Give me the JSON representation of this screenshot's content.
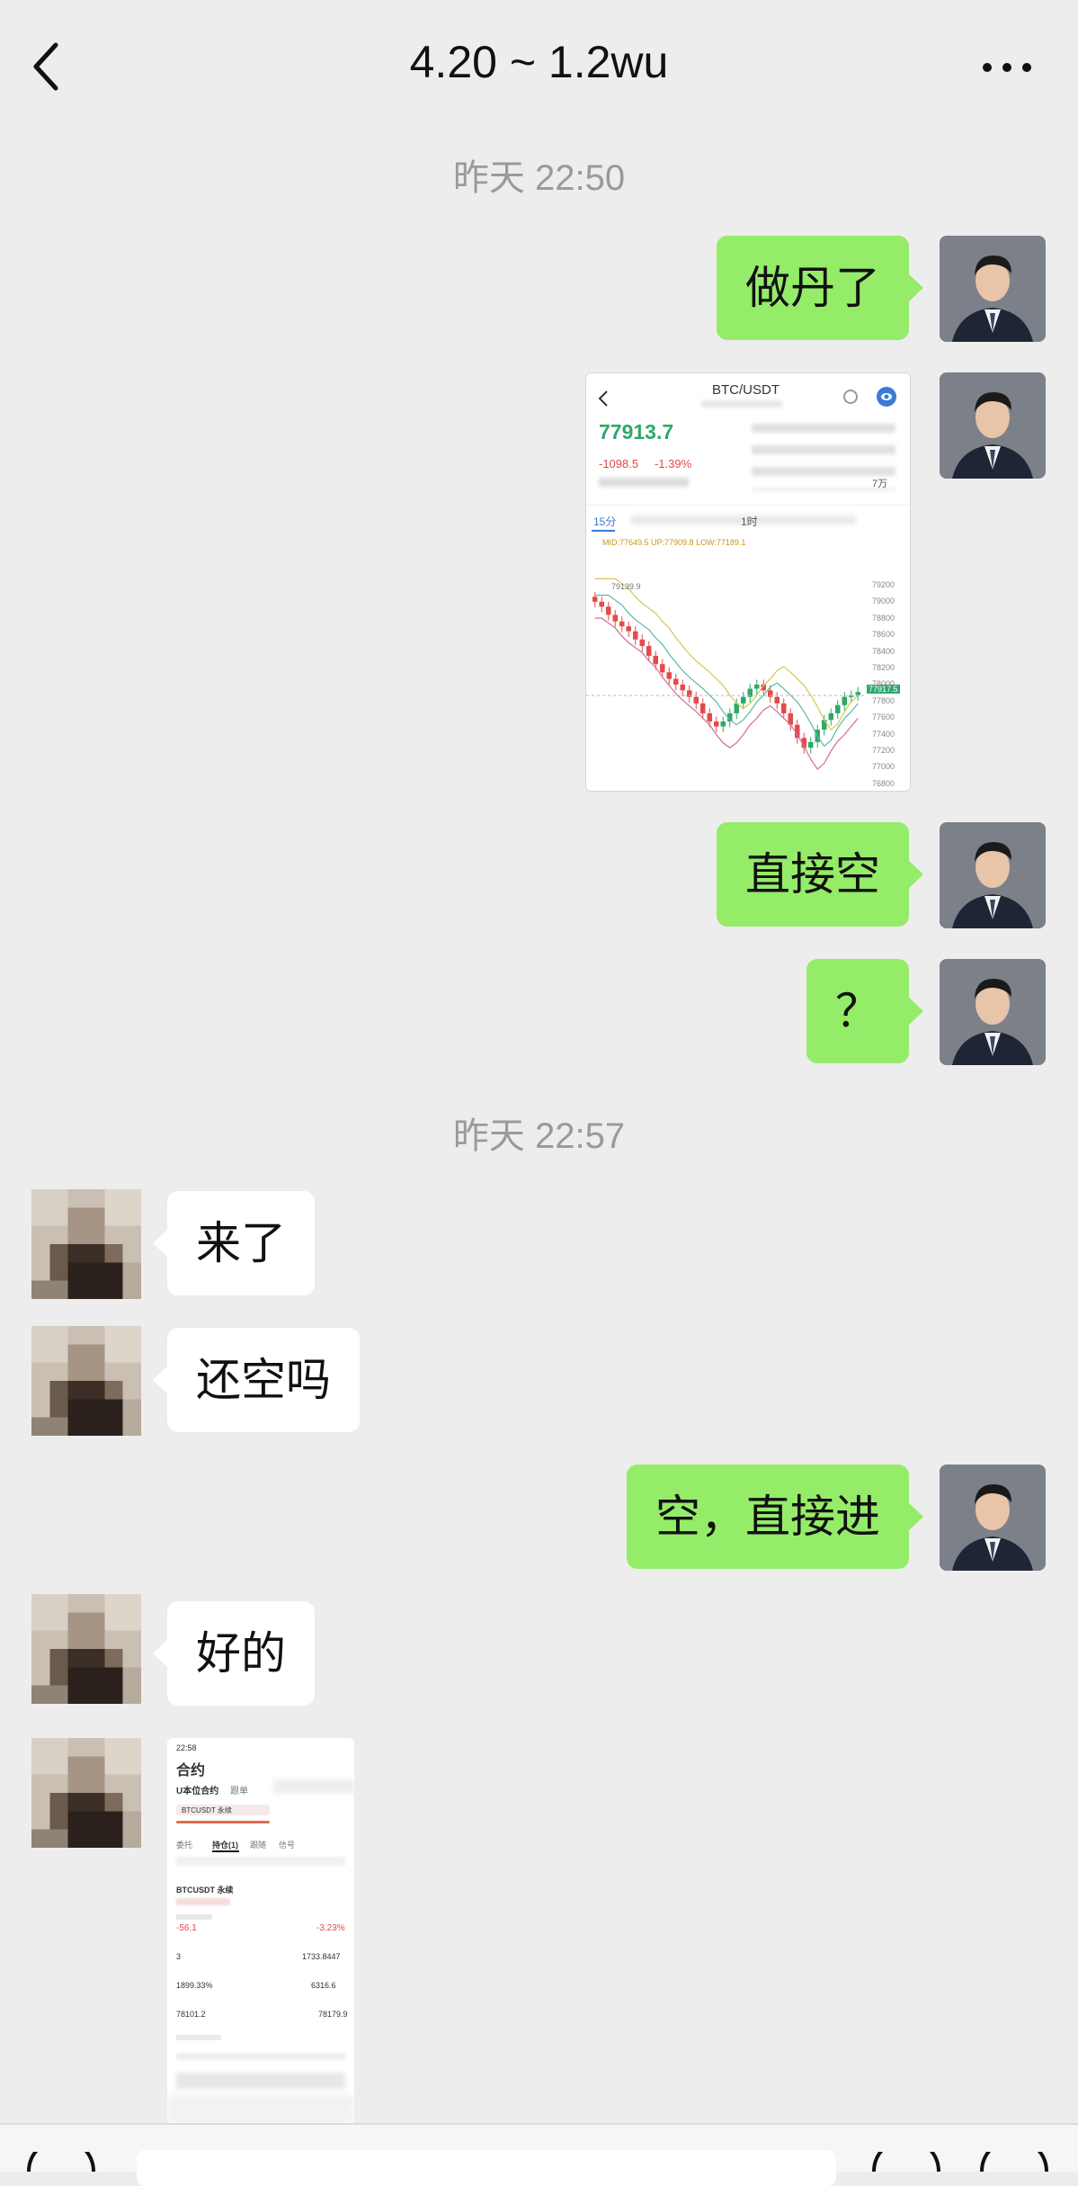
{
  "header": {
    "title": "4.20 ~ 1.2wu"
  },
  "icons": {
    "back": "chevron-left-icon",
    "more": "more-dots-icon",
    "voice": "voice-icon",
    "emoji": "emoji-icon",
    "plus": "plus-icon"
  },
  "colors": {
    "background": "#ededed",
    "my_bubble": "#95ec69",
    "their_bubble": "#ffffff",
    "timestamp": "#9a9a9a",
    "price_green": "#2ea86b",
    "price_red": "#e24b4b"
  },
  "timestamps": [
    "昨天 22:50",
    "昨天 22:57"
  ],
  "messages": [
    {
      "side": "me",
      "text": "做丹了"
    },
    {
      "side": "me",
      "type": "image",
      "image": {
        "pair": "BTC/USDT",
        "price": "77913.7",
        "change": "-1098.5",
        "change_pct": "-1.39%",
        "tabs": [
          "15分",
          "1时"
        ],
        "bands": "MID:77649.5  UP:77909.8  LOW:77189.1",
        "high_label": "79139.9",
        "right_price": "77917.5",
        "unit": "7万",
        "y_ticks": [
          "79200",
          "79000",
          "78800",
          "78600",
          "78400",
          "78200",
          "78000",
          "77800",
          "77600",
          "77400",
          "77200",
          "77000",
          "76800"
        ]
      }
    },
    {
      "side": "me",
      "text": "直接空"
    },
    {
      "side": "me",
      "text": "？"
    },
    {
      "side": "them",
      "text": "来了"
    },
    {
      "side": "them",
      "text": "还空吗"
    },
    {
      "side": "me",
      "text": "空，直接进"
    },
    {
      "side": "them",
      "text": "好的"
    },
    {
      "side": "them",
      "type": "image",
      "image": {
        "status_time": "22:58",
        "title": "合约",
        "tab": "U本位合约",
        "tab2": "跟单",
        "position_tabs": [
          "委托",
          "持仓(1)",
          "跟随",
          "信号"
        ],
        "symbol": "BTCUSDT 永续",
        "pnl": "-56.1",
        "pnl_pct": "-3.23%",
        "qty": "3",
        "margin": "1733.8447",
        "rate": "1899.33%",
        "value": "6316.6",
        "open_price": "78101.2",
        "mark_price": "78179.9"
      }
    }
  ]
}
